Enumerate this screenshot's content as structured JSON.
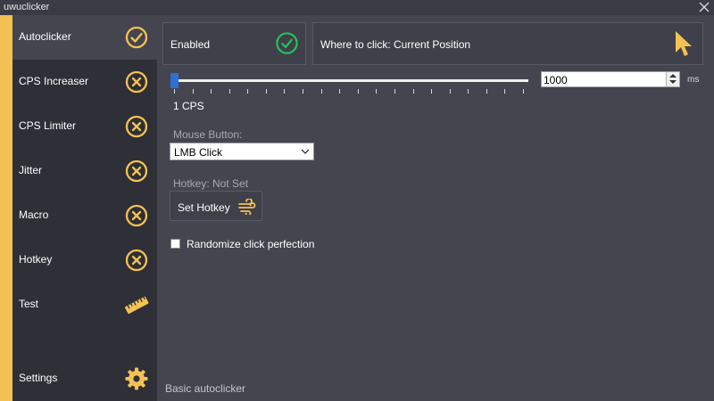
{
  "app": {
    "title": "uwuclicker"
  },
  "sidebar": {
    "items": [
      {
        "label": "Autoclicker",
        "icon": "check-circle-icon"
      },
      {
        "label": "CPS Increaser",
        "icon": "x-circle-icon"
      },
      {
        "label": "CPS Limiter",
        "icon": "x-circle-icon"
      },
      {
        "label": "Jitter",
        "icon": "x-circle-icon"
      },
      {
        "label": "Macro",
        "icon": "x-circle-icon"
      },
      {
        "label": "Hotkey",
        "icon": "x-circle-icon"
      },
      {
        "label": "Test",
        "icon": "ruler-icon"
      }
    ],
    "settings": {
      "label": "Settings",
      "icon": "gear-icon"
    },
    "active_index": 0
  },
  "main": {
    "enabled": {
      "label": "Enabled",
      "icon": "check-circle-icon"
    },
    "click_location": {
      "label": "Where to click: Current Position",
      "icon": "cursor-icon"
    },
    "interval": {
      "value": "1000",
      "unit": "ms",
      "cps_readout": "1 CPS",
      "slider_position_fraction": 0
    },
    "mouse_button": {
      "label": "Mouse Button:",
      "selected": "LMB Click"
    },
    "hotkey": {
      "label": "Hotkey: Not Set",
      "button_label": "Set Hotkey",
      "icon": "wind-icon"
    },
    "randomize": {
      "label": "Randomize click perfection",
      "checked": false
    },
    "footer": "Basic autoclicker"
  },
  "colors": {
    "accent": "#f4c253",
    "success": "#22c55e",
    "sidebar_bg": "#2f2f37",
    "main_bg": "#45454f"
  }
}
